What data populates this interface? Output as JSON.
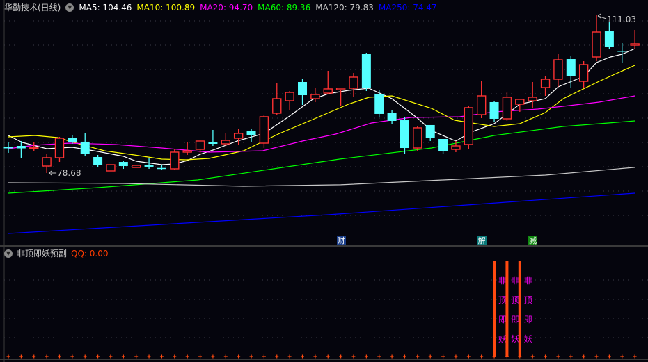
{
  "header": {
    "title": "华勤技术(日线)",
    "toggle_icon": "chevron-down-circle-icon",
    "ma_labels": [
      {
        "label": "MA5: 104.46",
        "color": "#ffffff"
      },
      {
        "label": "MA10: 100.89",
        "color": "#ffff00"
      },
      {
        "label": "MA20: 94.70",
        "color": "#ff00ff"
      },
      {
        "label": "MA60: 89.36",
        "color": "#00ff00"
      },
      {
        "label": "MA120: 79.83",
        "color": "#c8c8c8"
      },
      {
        "label": "MA250: 74.47",
        "color": "#0000ff"
      }
    ]
  },
  "events": [
    {
      "label": "财",
      "index": 26,
      "color": "#1a3e8a"
    },
    {
      "label": "解",
      "index": 37,
      "color": "#0a7a7a"
    },
    {
      "label": "减",
      "index": 41,
      "color": "#118a11"
    }
  ],
  "sub_panel": {
    "title": "非顶即妖预副",
    "indicator": "QQ: 0.00",
    "indicator_color": "#ff3c00",
    "signal_text": [
      "非",
      "顶",
      "即",
      "妖"
    ],
    "signal_indices": [
      38,
      39,
      40
    ],
    "text_color": "#e600e6",
    "bar_color": "#ff4a10"
  },
  "chart_data": {
    "type": "candlestick",
    "title": "华勤技术(日线)",
    "up_color": "#ff3232",
    "down_color": "#54ffff",
    "annotations": [
      {
        "label": "111.03",
        "index": 46,
        "price": 111.03,
        "kind": "high"
      },
      {
        "label": "78.68",
        "index": 3,
        "price": 78.68,
        "kind": "low"
      }
    ],
    "candles": [
      [
        83.96,
        83.81,
        84.95,
        82.82
      ],
      [
        84.24,
        83.74,
        85.24,
        81.82
      ],
      [
        83.96,
        83.96,
        84.95,
        83.1
      ],
      [
        80.11,
        81.82,
        82.53,
        78.68
      ],
      [
        81.82,
        85.81,
        86.09,
        80.96
      ],
      [
        85.81,
        84.95,
        86.52,
        84.67
      ],
      [
        85.1,
        82.53,
        86.95,
        82.1
      ],
      [
        81.96,
        80.39,
        82.39,
        79.82
      ],
      [
        79.11,
        80.39,
        80.39,
        79.11
      ],
      [
        80.96,
        80.11,
        81.1,
        79.54
      ],
      [
        79.82,
        80.25,
        80.25,
        79.82
      ],
      [
        80.25,
        79.97,
        81.82,
        79.54
      ],
      [
        79.72,
        79.54,
        80.25,
        79.25
      ],
      [
        79.54,
        82.96,
        83.53,
        79.25
      ],
      [
        82.96,
        83.24,
        84.95,
        82.39
      ],
      [
        83.53,
        85.24,
        85.24,
        82.53
      ],
      [
        84.95,
        84.67,
        87.52,
        84.24
      ],
      [
        84.67,
        85.38,
        86.81,
        84.24
      ],
      [
        85.81,
        86.81,
        87.8,
        84.53
      ],
      [
        87.23,
        86.52,
        87.8,
        85.1
      ],
      [
        84.81,
        90.23,
        90.51,
        83.81
      ],
      [
        90.94,
        93.93,
        97.21,
        90.65
      ],
      [
        93.5,
        95.21,
        95.5,
        91.65
      ],
      [
        97.35,
        94.64,
        97.92,
        92.65
      ],
      [
        93.93,
        94.78,
        96.21,
        93.22
      ],
      [
        95.07,
        95.93,
        99.63,
        94.93
      ],
      [
        95.78,
        96.07,
        96.21,
        92.5
      ],
      [
        96.07,
        98.35,
        99.2,
        94.22
      ],
      [
        103.19,
        96.07,
        103.33,
        95.5
      ],
      [
        94.93,
        90.8,
        95.78,
        90.08
      ],
      [
        90.94,
        89.37,
        91.51,
        88.66
      ],
      [
        89.51,
        83.81,
        90.23,
        82.53
      ],
      [
        83.81,
        87.95,
        88.37,
        83.1
      ],
      [
        88.52,
        85.95,
        88.52,
        85.24
      ],
      [
        85.67,
        83.24,
        85.67,
        82.53
      ],
      [
        83.53,
        84.24,
        85.24,
        82.96
      ],
      [
        84.53,
        92.08,
        92.36,
        83.67
      ],
      [
        90.65,
        94.5,
        97.63,
        89.94
      ],
      [
        93.22,
        89.8,
        93.36,
        89.08
      ],
      [
        89.8,
        94.22,
        95.36,
        89.37
      ],
      [
        92.79,
        93.79,
        93.79,
        91.22
      ],
      [
        93.5,
        94.22,
        97.35,
        91.93
      ],
      [
        96.21,
        97.92,
        98.63,
        94.5
      ],
      [
        97.92,
        101.91,
        103.19,
        96.35
      ],
      [
        102.05,
        98.49,
        102.62,
        96.07
      ],
      [
        97.49,
        100.91,
        101.62,
        96.21
      ],
      [
        102.48,
        107.61,
        111.03,
        101.62
      ],
      [
        107.75,
        104.48,
        109.6,
        104.19
      ],
      [
        103.76,
        103.69,
        105.33,
        101.2
      ],
      [
        104.9,
        105.19,
        108.04,
        104.19
      ]
    ],
    "candle_format": [
      "open",
      "close",
      "high",
      "low"
    ],
    "ma_series": [
      {
        "name": "MA5",
        "color": "#ffffff",
        "points": [
          [
            0,
            86.38
          ],
          [
            1.1,
            84.95
          ],
          [
            3,
            83.67
          ],
          [
            5,
            83.96
          ],
          [
            7,
            83.1
          ],
          [
            9,
            82.1
          ],
          [
            10,
            81.1
          ],
          [
            12,
            80.39
          ],
          [
            13,
            80.53
          ],
          [
            14,
            81.25
          ],
          [
            15,
            82.53
          ],
          [
            16,
            83.39
          ],
          [
            17.9,
            85.24
          ],
          [
            20,
            86.81
          ],
          [
            22,
            90.37
          ],
          [
            23.8,
            93.79
          ],
          [
            25,
            94.93
          ],
          [
            26.6,
            95.64
          ],
          [
            28.2,
            96.07
          ],
          [
            30,
            93.93
          ],
          [
            32,
            89.94
          ],
          [
            33.1,
            87.37
          ],
          [
            35,
            85.24
          ],
          [
            36.2,
            87.09
          ],
          [
            38,
            88.8
          ],
          [
            40,
            92.79
          ],
          [
            42,
            93.93
          ],
          [
            43,
            96.35
          ],
          [
            45,
            98.49
          ],
          [
            46,
            101.34
          ],
          [
            47.1,
            102.48
          ],
          [
            48,
            103.05
          ],
          [
            49,
            104.19
          ]
        ]
      },
      {
        "name": "MA10",
        "color": "#ffff00",
        "points": [
          [
            0,
            86.09
          ],
          [
            2.07,
            86.38
          ],
          [
            3.87,
            85.95
          ],
          [
            5.7,
            84.53
          ],
          [
            7.5,
            83.24
          ],
          [
            9.85,
            82.39
          ],
          [
            12,
            81.53
          ],
          [
            13.9,
            81.39
          ],
          [
            15.7,
            81.67
          ],
          [
            18.4,
            83.24
          ],
          [
            21.1,
            86.66
          ],
          [
            23.8,
            89.65
          ],
          [
            26.6,
            92.79
          ],
          [
            28.2,
            94.22
          ],
          [
            30,
            94.5
          ],
          [
            33.1,
            91.93
          ],
          [
            34.9,
            89.51
          ],
          [
            38,
            88.23
          ],
          [
            40,
            88.8
          ],
          [
            42,
            91.08
          ],
          [
            43.4,
            93.93
          ],
          [
            46.2,
            97.49
          ],
          [
            49,
            100.77
          ]
        ]
      },
      {
        "name": "MA20",
        "color": "#ff00ff",
        "points": [
          [
            0,
            83.67
          ],
          [
            2.07,
            84.38
          ],
          [
            4.8,
            84.81
          ],
          [
            8.4,
            84.53
          ],
          [
            12,
            83.81
          ],
          [
            15.7,
            82.96
          ],
          [
            19.9,
            83.24
          ],
          [
            23,
            85.24
          ],
          [
            25.6,
            86.66
          ],
          [
            28.4,
            88.94
          ],
          [
            31.5,
            90.08
          ],
          [
            35.3,
            90.22
          ],
          [
            38,
            91.22
          ],
          [
            41.4,
            91.79
          ],
          [
            43.4,
            92.36
          ],
          [
            46.2,
            93.22
          ],
          [
            49,
            94.5
          ]
        ]
      },
      {
        "name": "MA60",
        "color": "#00ff00",
        "points": [
          [
            0,
            74.55
          ],
          [
            7,
            75.69
          ],
          [
            14.8,
            77.26
          ],
          [
            25.9,
            81.53
          ],
          [
            33.1,
            83.81
          ],
          [
            38,
            86.38
          ],
          [
            43.4,
            88.23
          ],
          [
            49,
            89.37
          ]
        ]
      },
      {
        "name": "MA120",
        "color": "#c8c8c8",
        "points": [
          [
            0,
            76.69
          ],
          [
            9,
            76.55
          ],
          [
            18.4,
            75.97
          ],
          [
            26,
            76.27
          ],
          [
            34,
            77.26
          ],
          [
            42,
            78.26
          ],
          [
            49,
            79.83
          ]
        ]
      },
      {
        "name": "MA250",
        "color": "#0000ff",
        "points": [
          [
            0,
            66.29
          ],
          [
            25,
            70.13
          ],
          [
            49,
            74.55
          ]
        ]
      }
    ]
  }
}
